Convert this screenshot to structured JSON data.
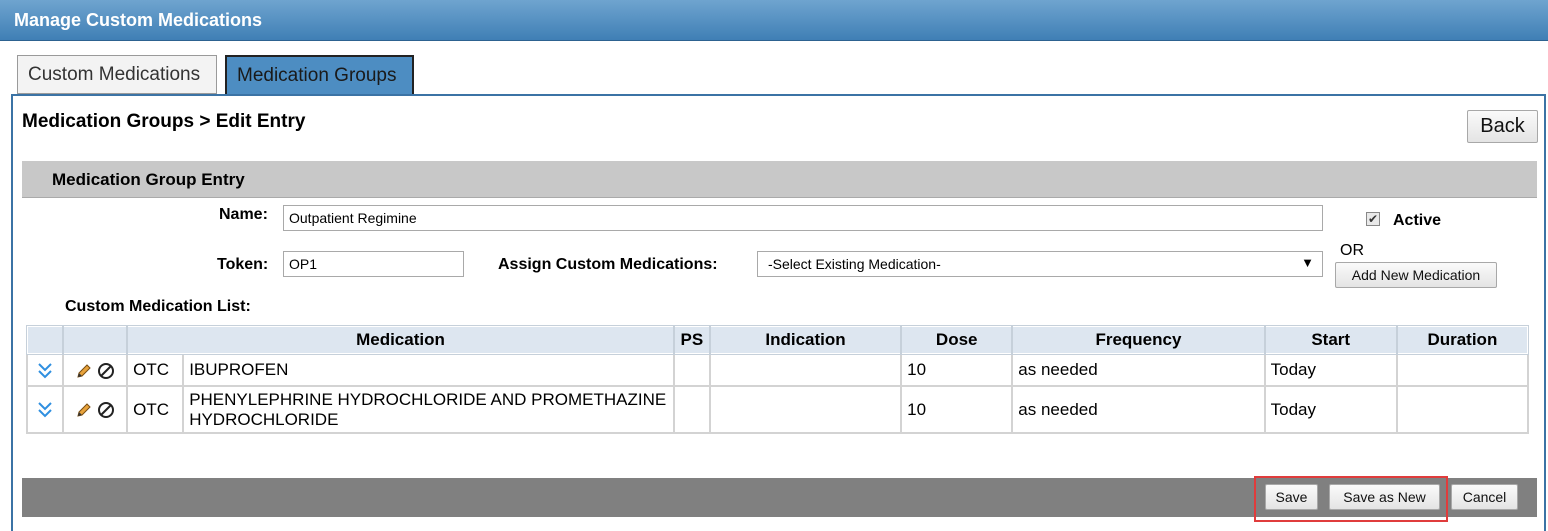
{
  "window": {
    "title": "Manage Custom Medications"
  },
  "tabs": [
    {
      "label": "Custom Medications",
      "active": false
    },
    {
      "label": "Medication Groups",
      "active": true
    }
  ],
  "page": {
    "title": "Medication Groups > Edit Entry",
    "back_label": "Back"
  },
  "section": {
    "title": "Medication Group Entry"
  },
  "form": {
    "name_label": "Name:",
    "name_value": "Outpatient Regimine",
    "active_label": "Active",
    "active_checked": true,
    "token_label": "Token:",
    "token_value": "OP1",
    "assign_label": "Assign Custom Medications:",
    "assign_selected": "-Select Existing Medication-",
    "or_label": "OR",
    "add_new_label": "Add New Medication",
    "list_label": "Custom Medication List:"
  },
  "table": {
    "headers": [
      "Medication",
      "PS",
      "Indication",
      "Dose",
      "Frequency",
      "Start",
      "Duration"
    ],
    "rows": [
      {
        "type": "OTC",
        "medication": "IBUPROFEN",
        "ps": "",
        "indication": "",
        "dose": "10",
        "frequency": "as needed",
        "start": "Today",
        "duration": ""
      },
      {
        "type": "OTC",
        "medication": "PHENYLEPHRINE HYDROCHLORIDE AND PROMETHAZINE HYDROCHLORIDE",
        "ps": "",
        "indication": "",
        "dose": "10",
        "frequency": "as needed",
        "start": "Today",
        "duration": ""
      }
    ]
  },
  "footer": {
    "save_label": "Save",
    "save_as_new_label": "Save as New",
    "cancel_label": "Cancel"
  },
  "icons": {
    "expand": "double-chevron-down-icon",
    "edit": "pencil-icon",
    "remove": "ban-icon"
  },
  "colors": {
    "titlebar": "#4f8ec4",
    "active_tab": "#4d8dc2",
    "highlight": "#e03c3c"
  }
}
